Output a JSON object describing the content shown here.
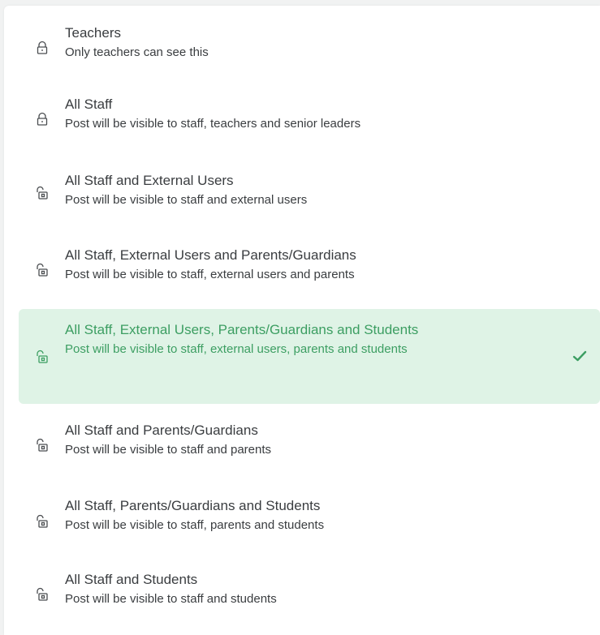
{
  "colors": {
    "text": "#3a3d40",
    "accent": "#3c9e62",
    "selected_bg": "#dff3e6",
    "icon": "#4a4d50"
  },
  "options": [
    {
      "title": "Teachers",
      "description": "Only teachers can see this",
      "icon": "lock-closed-icon",
      "selected": false
    },
    {
      "title": "All Staff",
      "description": "Post will be visible to staff, teachers and senior leaders",
      "icon": "lock-closed-icon",
      "selected": false
    },
    {
      "title": "All Staff and External Users",
      "description": "Post will be visible to staff and external users",
      "icon": "lock-open-icon",
      "selected": false
    },
    {
      "title": "All Staff, External Users and Parents/Guardians",
      "description": "Post will be visible to staff, external users and parents",
      "icon": "lock-open-icon",
      "selected": false
    },
    {
      "title": "All Staff, External Users, Parents/Guardians and Students",
      "description": "Post will be visible to staff, external users, parents and students",
      "icon": "lock-open-icon",
      "selected": true
    },
    {
      "title": "All Staff and Parents/Guardians",
      "description": "Post will be visible to staff and parents",
      "icon": "lock-open-icon",
      "selected": false
    },
    {
      "title": "All Staff, Parents/Guardians and Students",
      "description": "Post will be visible to staff, parents and students",
      "icon": "lock-open-icon",
      "selected": false
    },
    {
      "title": "All Staff and Students",
      "description": "Post will be visible to staff and students",
      "icon": "lock-open-icon",
      "selected": false
    }
  ]
}
